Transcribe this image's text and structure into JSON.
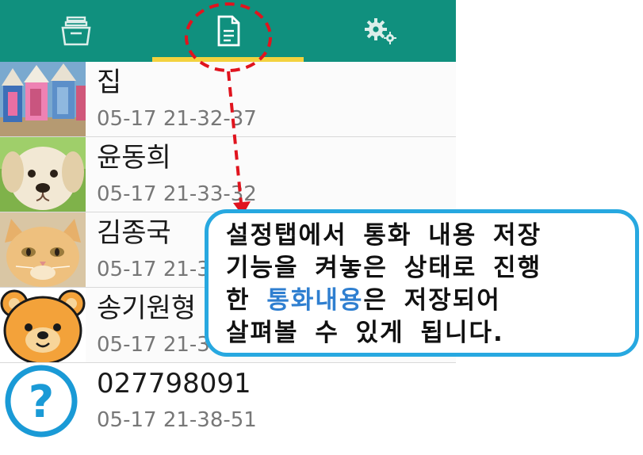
{
  "tabs": [
    {
      "icon": "archive-box-icon"
    },
    {
      "icon": "document-icon",
      "selected": true
    },
    {
      "icon": "settings-gears-icon"
    }
  ],
  "colors": {
    "tabbar": "#10907e",
    "tab_indicator": "#f3d23e",
    "annotation_red": "#e0141e",
    "callout_border": "#27a8e0",
    "highlight_text": "#2f7fd0"
  },
  "contacts": [
    {
      "name": "집",
      "time": "05-17 21-32-37",
      "avatar": "beach-huts-photo"
    },
    {
      "name": "윤동희",
      "time": "05-17 21-33-32",
      "avatar": "puppy-photo"
    },
    {
      "name": "김종국",
      "time": "05-17 21-3",
      "avatar": "kitten-photo"
    },
    {
      "name": "송기원형",
      "time": "05-17 21-3",
      "avatar": "bear-cartoon"
    },
    {
      "name": "027798091",
      "time": "05-17 21-38-51",
      "avatar": "unknown-contact-icon"
    }
  ],
  "callout": {
    "line1": "설정탭에서 통화 내용 저장",
    "line2": "기능을 켜놓은 상태로 진행",
    "line3_pre": "한 ",
    "line3_highlight": "통화내용",
    "line3_post": "은 저장되어",
    "line4": "살펴볼 수 있게 됩니다."
  }
}
